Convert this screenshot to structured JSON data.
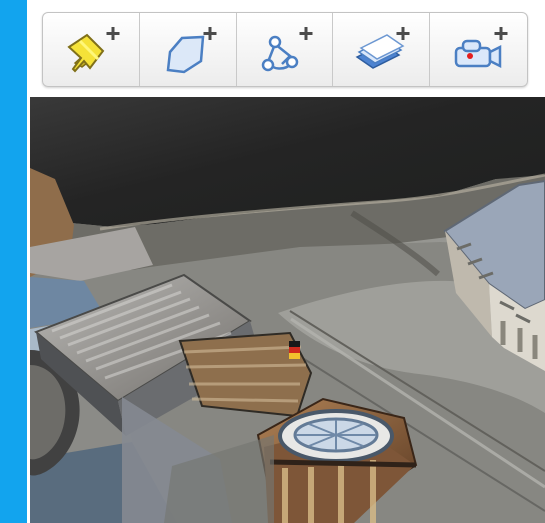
{
  "toolbar": {
    "buttons": [
      {
        "name": "add-placemark-button",
        "icon": "pushpin-plus-icon"
      },
      {
        "name": "add-polygon-button",
        "icon": "polygon-plus-icon"
      },
      {
        "name": "add-path-button",
        "icon": "path-plus-icon"
      },
      {
        "name": "add-image-overlay-button",
        "icon": "overlay-plus-icon"
      },
      {
        "name": "record-tour-button",
        "icon": "camera-plus-icon"
      }
    ]
  },
  "colors": {
    "left_rail": "#12a4ee",
    "toolbar_background": "#f4f4f4",
    "icon_blue": "#4b7fc3",
    "pin_yellow": "#f5e238"
  },
  "map": {
    "view": "3D aerial"
  }
}
